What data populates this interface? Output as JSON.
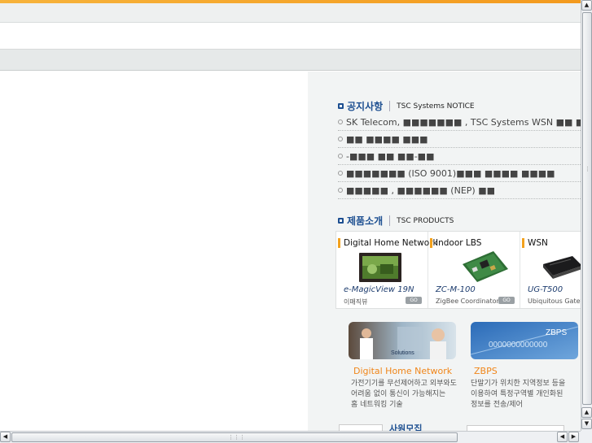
{
  "notice": {
    "title_ko": "공지사항",
    "title_en": "TSC Systems NOTICE",
    "items": [
      "SK Telecom, ■■■■■■■ , TSC Systems WSN ■■ ■■",
      "■■ ■■■■ ■■■",
      "-■■■ ■■ ■■-■■",
      "■■■■■■■ (ISO 9001)■■■ ■■■■ ■■■■",
      "■■■■■ , ■■■■■■ (NEP) ■■"
    ]
  },
  "products": {
    "title_ko": "제품소개",
    "title_en": "TSC PRODUCTS",
    "go_label": "GO",
    "items": [
      {
        "category": "Digital Home Network",
        "model": "e-MagicView 19N",
        "subtitle": "이매직뷰"
      },
      {
        "category": "Indoor LBS",
        "model": "ZC-M-100",
        "subtitle": "ZigBee Coordinator"
      },
      {
        "category": "WSN",
        "model": "UG-T500",
        "subtitle": "Ubiquitous Gateway"
      }
    ]
  },
  "solutions": [
    {
      "image_caption": "Solutions",
      "title": "Digital Home Network",
      "desc_lines": [
        "가전기기를 무선제어하고 외부와도",
        "어려움 없이 통신이 가능해지는",
        "홈 네트워킹 기술"
      ]
    },
    {
      "image_caption": "ZBPS",
      "image_digits": "0000000000000",
      "title": "ZBPS",
      "desc_lines": [
        "단말기가 위치한 지역정보 등을",
        "이용하여 특정구역별 개인화된",
        "정보를 전송/제어"
      ]
    }
  ],
  "bottom": {
    "label": "사원모집"
  },
  "scrollbars": {
    "up_arrow": "▲",
    "down_arrow": "▼",
    "left_arrow": "◀",
    "right_arrow": "▶"
  },
  "colors": {
    "accent": "#f39a1e",
    "heading": "#1d4f91",
    "solution_title": "#f0861a"
  }
}
